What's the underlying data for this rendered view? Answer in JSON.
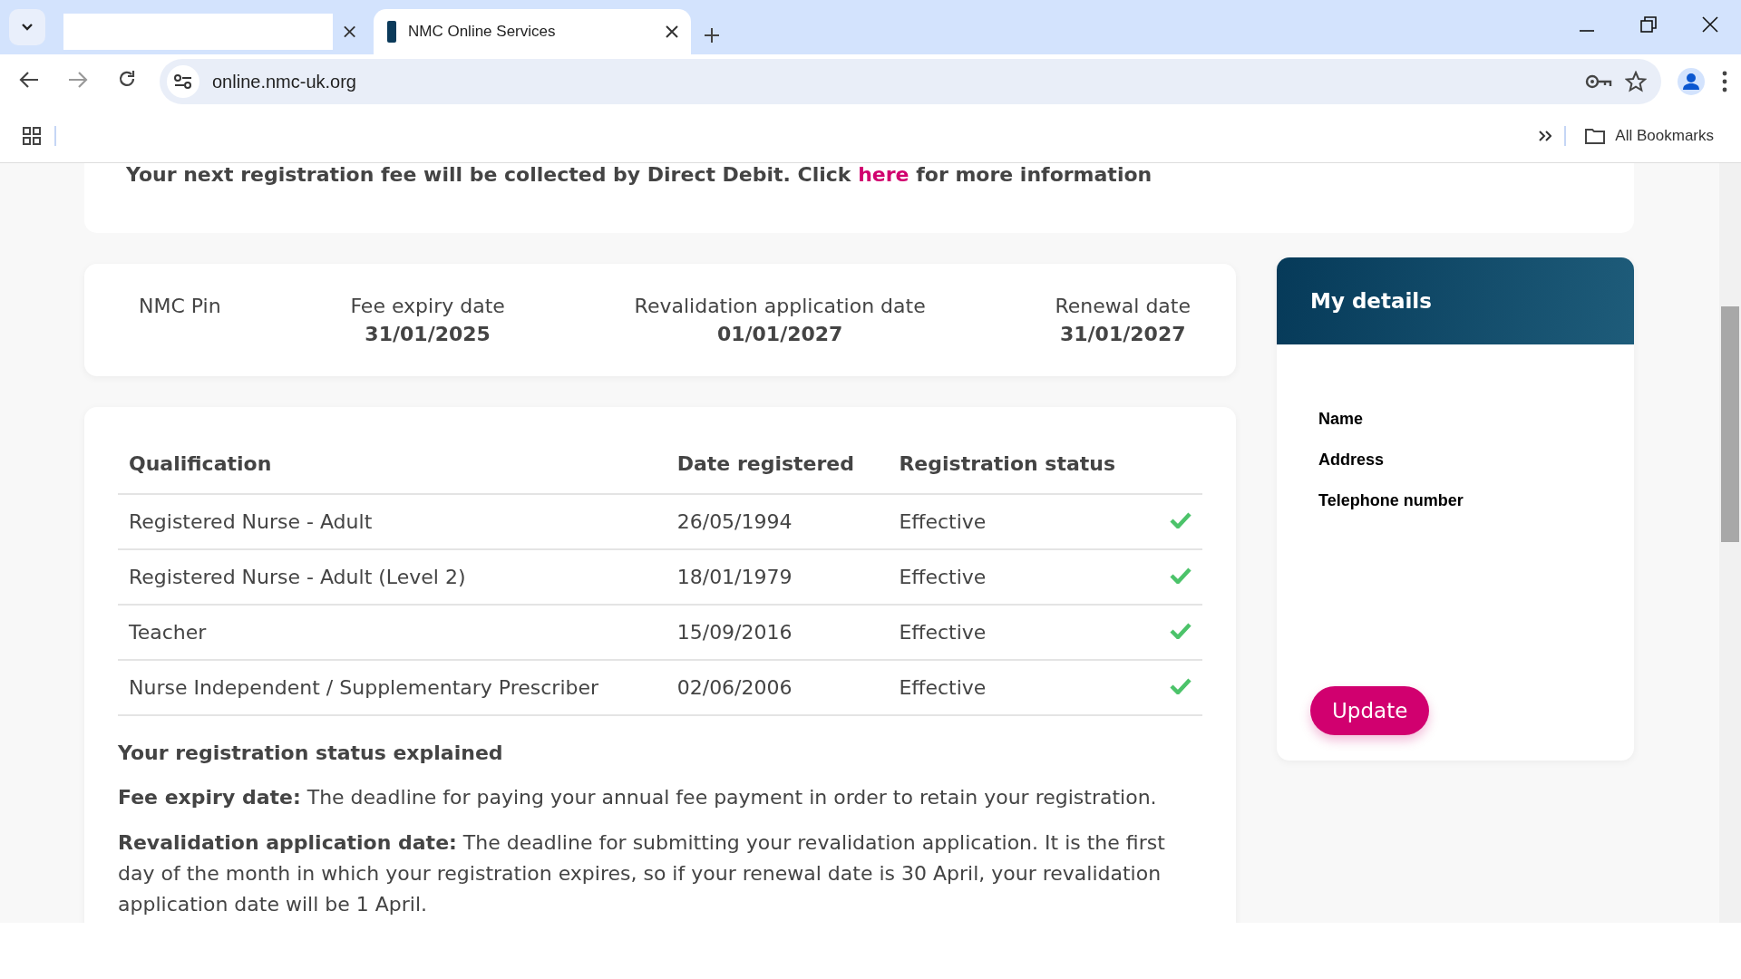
{
  "browser": {
    "tabs": [
      {
        "selected": false
      },
      {
        "title": "NMC Online Services",
        "selected": true
      }
    ],
    "address": "online.nmc-uk.org",
    "bookmarks_label": "All Bookmarks"
  },
  "notice": {
    "before": "Your next registration fee will be collected by Direct Debit. Click ",
    "link": "here",
    "after": " for more information"
  },
  "summary": [
    {
      "label": "NMC Pin"
    },
    {
      "label": "Fee expiry date",
      "value": "31/01/2025"
    },
    {
      "label": "Revalidation application date",
      "value": "01/01/2027"
    },
    {
      "label": "Renewal date",
      "value": "31/01/2027"
    }
  ],
  "table": {
    "columns": [
      "Qualification",
      "Date registered",
      "Registration status"
    ],
    "rows": [
      {
        "qualification": "Registered Nurse - Adult",
        "date": "26/05/1994",
        "status": "Effective"
      },
      {
        "qualification": "Registered Nurse - Adult (Level 2)",
        "date": "18/01/1979",
        "status": "Effective"
      },
      {
        "qualification": "Teacher",
        "date": "15/09/2016",
        "status": "Effective"
      },
      {
        "qualification": "Nurse Independent / Supplementary Prescriber",
        "date": "02/06/2006",
        "status": "Effective"
      }
    ]
  },
  "explained": {
    "title": "Your registration status explained",
    "paragraphs": [
      "**Fee expiry date:** The deadline for paying your annual fee payment in order to retain your registration.",
      "**Revalidation application date:** The deadline for submitting your revalidation application. It is the first day of the month in which your registration expires, so if your renewal date is 30 April, your revalidation application date will be 1 April."
    ]
  },
  "my_details": {
    "title": "My details",
    "fields": [
      "Name",
      "Address",
      "Telephone number"
    ],
    "button": "Update"
  }
}
